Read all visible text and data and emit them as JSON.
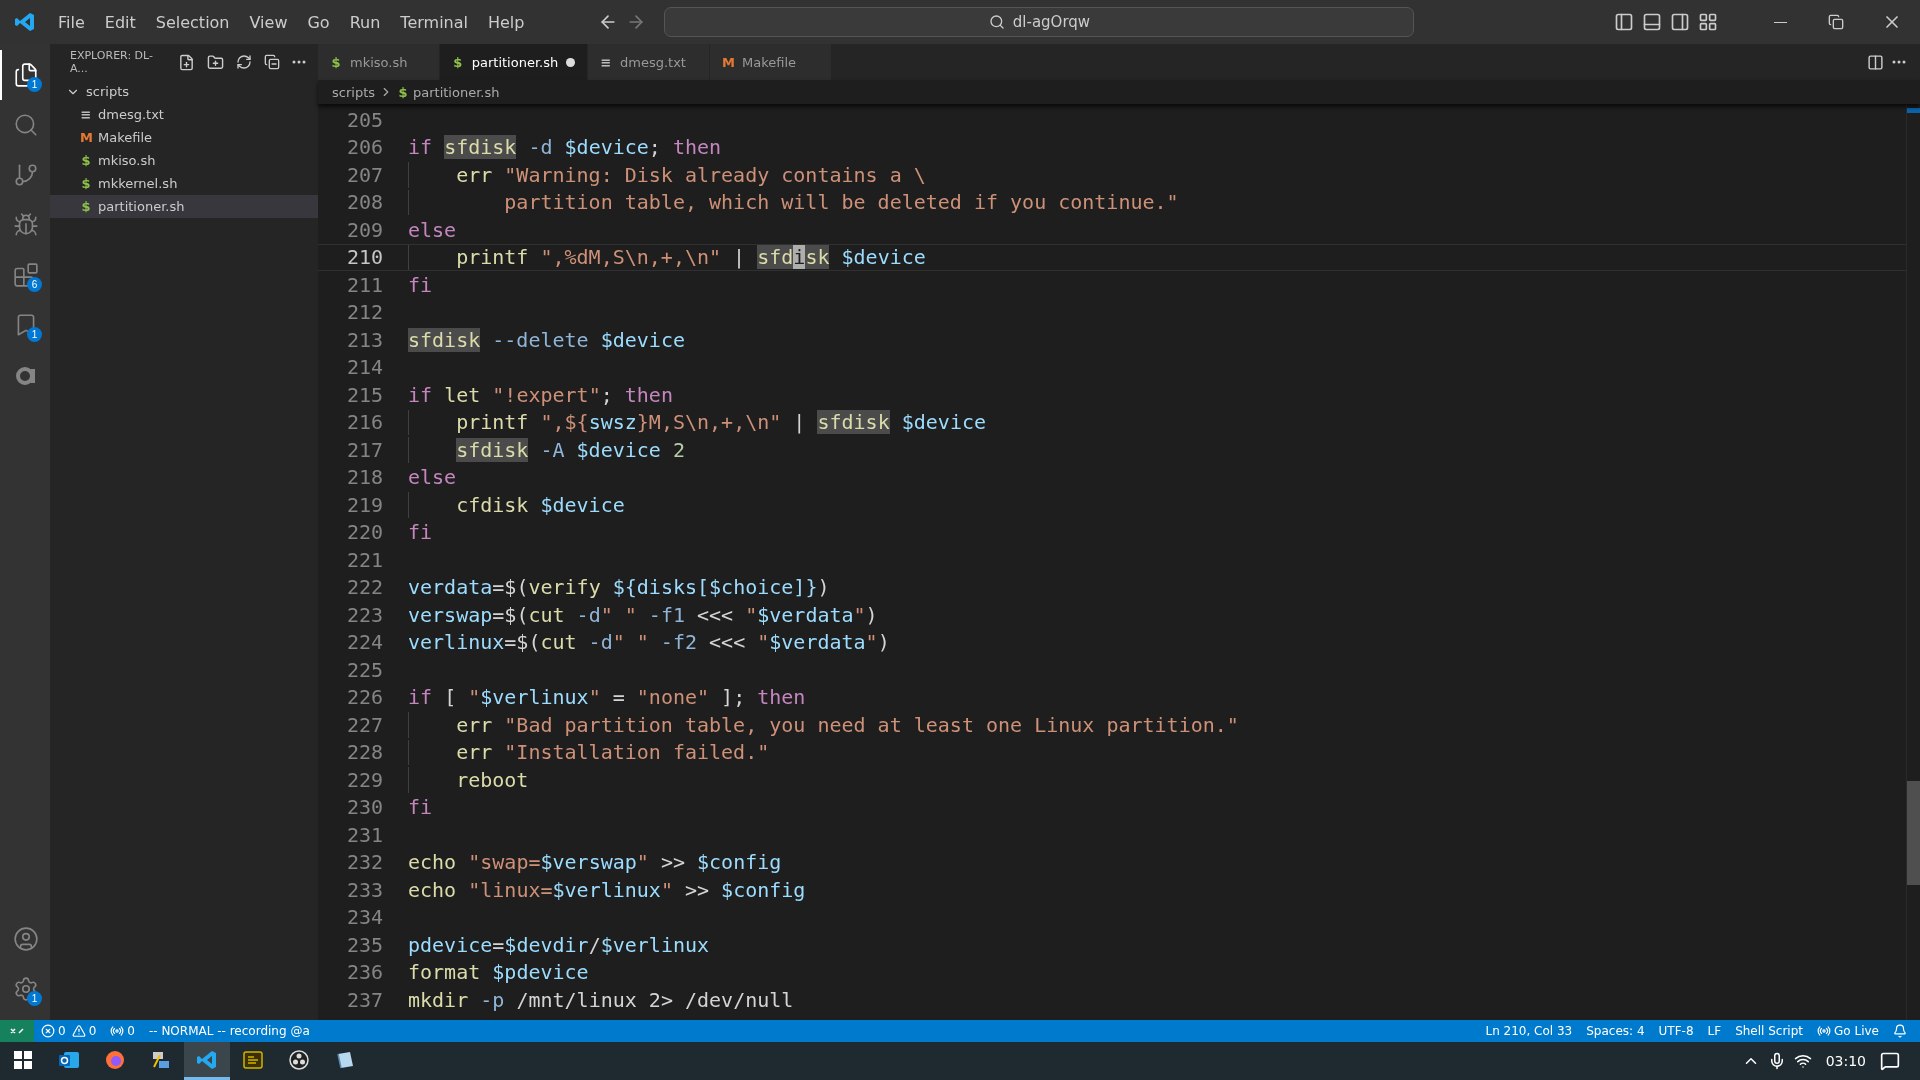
{
  "title_bar": {
    "menu": [
      "File",
      "Edit",
      "Selection",
      "View",
      "Go",
      "Run",
      "Terminal",
      "Help"
    ],
    "search": {
      "value": "dl-agOrqw"
    }
  },
  "activity_bar": {
    "items": [
      {
        "kind": "explorer",
        "selected": true,
        "badge": "1"
      },
      {
        "kind": "search",
        "selected": false
      },
      {
        "kind": "source-control",
        "selected": false
      },
      {
        "kind": "run",
        "selected": false
      },
      {
        "kind": "extensions",
        "selected": false,
        "badge": "6"
      },
      {
        "kind": "bookmark",
        "selected": false,
        "badge": "1"
      },
      {
        "kind": "ring",
        "selected": false
      }
    ],
    "bottom": [
      {
        "kind": "account"
      },
      {
        "kind": "settings",
        "badge": "1"
      }
    ]
  },
  "sidebar": {
    "title": "EXPLORER: DL-A...",
    "tree": [
      {
        "label": "scripts",
        "expanded": true,
        "selected": false,
        "children": [
          {
            "label": "dmesg.txt",
            "icon": "≡",
            "kind": "text",
            "selected": false
          },
          {
            "label": "Makefile",
            "icon": "M",
            "kind": "make",
            "selected": false
          },
          {
            "label": "mkiso.sh",
            "icon": "$",
            "kind": "shell",
            "selected": false
          },
          {
            "label": "mkkernel.sh",
            "icon": "$",
            "kind": "shell",
            "selected": false
          },
          {
            "label": "partitioner.sh",
            "icon": "$",
            "kind": "shell",
            "selected": true
          }
        ]
      }
    ]
  },
  "tabs": [
    {
      "label": "mkiso.sh",
      "icon": "$",
      "kind": "shell",
      "selected": false,
      "modified": false
    },
    {
      "label": "partitioner.sh",
      "icon": "$",
      "kind": "shell",
      "selected": true,
      "modified": true
    },
    {
      "label": "dmesg.txt",
      "icon": "≡",
      "kind": "text",
      "selected": false,
      "modified": false
    },
    {
      "label": "Makefile",
      "icon": "M",
      "kind": "make",
      "selected": false,
      "modified": false
    }
  ],
  "breadcrumbs": [
    {
      "label": "scripts"
    },
    {
      "label": "partitioner.sh",
      "icon": "$"
    }
  ],
  "editor": {
    "lines": [
      {
        "number": "205",
        "current": false
      },
      {
        "number": "206",
        "current": false,
        "indented": false,
        "tokens": [
          {
            "kind": "kw",
            "text": "if "
          },
          {
            "kind": "match",
            "text": "sfdisk"
          },
          {
            "kind": "flag",
            "text": " -d "
          },
          {
            "kind": "var",
            "text": "$device"
          },
          {
            "kind": "plain",
            "text": "; "
          },
          {
            "kind": "kw",
            "text": "then"
          }
        ]
      },
      {
        "number": "207",
        "current": false,
        "indented": true,
        "tokens": [
          {
            "kind": "fn",
            "text": "err "
          },
          {
            "kind": "str",
            "text": "\"Warning: Disk already contains a \\"
          }
        ]
      },
      {
        "number": "208",
        "current": false,
        "indented": true,
        "tokens": [
          {
            "kind": "str",
            "text": "    partition table, which will be deleted if you continue.\""
          }
        ]
      },
      {
        "number": "209",
        "current": false,
        "indented": false,
        "tokens": [
          {
            "kind": "kw",
            "text": "else"
          }
        ]
      },
      {
        "number": "210",
        "current": true,
        "indented": true,
        "tokens": [
          {
            "kind": "fn",
            "text": "printf "
          },
          {
            "kind": "str",
            "text": "\",%dM,S\\n,+,\\n\""
          },
          {
            "kind": "plain",
            "text": " | "
          },
          {
            "kind": "match",
            "text": "sfd"
          },
          {
            "kind": "cursor",
            "text": "i"
          },
          {
            "kind": "match",
            "text": "sk"
          },
          {
            "kind": "var",
            "text": " $device"
          }
        ]
      },
      {
        "number": "211",
        "current": false,
        "indented": false,
        "tokens": [
          {
            "kind": "kw",
            "text": "fi"
          }
        ]
      },
      {
        "number": "212",
        "current": false
      },
      {
        "number": "213",
        "current": false,
        "indented": false,
        "tokens": [
          {
            "kind": "match",
            "text": "sfdisk"
          },
          {
            "kind": "flag",
            "text": " --delete "
          },
          {
            "kind": "var",
            "text": "$device"
          }
        ]
      },
      {
        "number": "214",
        "current": false
      },
      {
        "number": "215",
        "current": false,
        "indented": false,
        "tokens": [
          {
            "kind": "kw",
            "text": "if "
          },
          {
            "kind": "fn",
            "text": "let "
          },
          {
            "kind": "str",
            "text": "\"!expert\""
          },
          {
            "kind": "plain",
            "text": "; "
          },
          {
            "kind": "kw",
            "text": "then"
          }
        ]
      },
      {
        "number": "216",
        "current": false,
        "indented": true,
        "tokens": [
          {
            "kind": "fn",
            "text": "printf "
          },
          {
            "kind": "str",
            "text": "\",${"
          },
          {
            "kind": "var",
            "text": "swsz"
          },
          {
            "kind": "str",
            "text": "}M,S\\n,+,\\n\""
          },
          {
            "kind": "plain",
            "text": " | "
          },
          {
            "kind": "match",
            "text": "sfdisk"
          },
          {
            "kind": "var",
            "text": " $device"
          }
        ]
      },
      {
        "number": "217",
        "current": false,
        "indented": true,
        "tokens": [
          {
            "kind": "match",
            "text": "sfdisk"
          },
          {
            "kind": "flag",
            "text": " -A "
          },
          {
            "kind": "var",
            "text": "$device"
          },
          {
            "kind": "num",
            "text": " 2"
          }
        ]
      },
      {
        "number": "218",
        "current": false,
        "indented": false,
        "tokens": [
          {
            "kind": "kw",
            "text": "else"
          }
        ]
      },
      {
        "number": "219",
        "current": false,
        "indented": true,
        "tokens": [
          {
            "kind": "fn",
            "text": "cfdisk "
          },
          {
            "kind": "var",
            "text": "$device"
          }
        ]
      },
      {
        "number": "220",
        "current": false,
        "indented": false,
        "tokens": [
          {
            "kind": "kw",
            "text": "fi"
          }
        ]
      },
      {
        "number": "221",
        "current": false
      },
      {
        "number": "222",
        "current": false,
        "indented": false,
        "tokens": [
          {
            "kind": "var",
            "text": "verdata"
          },
          {
            "kind": "plain",
            "text": "=$("
          },
          {
            "kind": "fn",
            "text": "verify "
          },
          {
            "kind": "var",
            "text": "${disks[$choice]}"
          },
          {
            "kind": "plain",
            "text": ")"
          }
        ]
      },
      {
        "number": "223",
        "current": false,
        "indented": false,
        "tokens": [
          {
            "kind": "var",
            "text": "verswap"
          },
          {
            "kind": "plain",
            "text": "=$("
          },
          {
            "kind": "fn",
            "text": "cut"
          },
          {
            "kind": "flag",
            "text": " -d"
          },
          {
            "kind": "str",
            "text": "\" \""
          },
          {
            "kind": "flag",
            "text": " -f1 "
          },
          {
            "kind": "plain",
            "text": "<<< "
          },
          {
            "kind": "str",
            "text": "\""
          },
          {
            "kind": "var",
            "text": "$verdata"
          },
          {
            "kind": "str",
            "text": "\""
          },
          {
            "kind": "plain",
            "text": ")"
          }
        ]
      },
      {
        "number": "224",
        "current": false,
        "indented": false,
        "tokens": [
          {
            "kind": "var",
            "text": "verlinux"
          },
          {
            "kind": "plain",
            "text": "=$("
          },
          {
            "kind": "fn",
            "text": "cut"
          },
          {
            "kind": "flag",
            "text": " -d"
          },
          {
            "kind": "str",
            "text": "\" \""
          },
          {
            "kind": "flag",
            "text": " -f2 "
          },
          {
            "kind": "plain",
            "text": "<<< "
          },
          {
            "kind": "str",
            "text": "\""
          },
          {
            "kind": "var",
            "text": "$verdata"
          },
          {
            "kind": "str",
            "text": "\""
          },
          {
            "kind": "plain",
            "text": ")"
          }
        ]
      },
      {
        "number": "225",
        "current": false
      },
      {
        "number": "226",
        "current": false,
        "indented": false,
        "tokens": [
          {
            "kind": "kw",
            "text": "if "
          },
          {
            "kind": "plain",
            "text": "[ "
          },
          {
            "kind": "str",
            "text": "\""
          },
          {
            "kind": "var",
            "text": "$verlinux"
          },
          {
            "kind": "str",
            "text": "\""
          },
          {
            "kind": "plain",
            "text": " = "
          },
          {
            "kind": "str",
            "text": "\"none\""
          },
          {
            "kind": "plain",
            "text": " ]; "
          },
          {
            "kind": "kw",
            "text": "then"
          }
        ]
      },
      {
        "number": "227",
        "current": false,
        "indented": true,
        "tokens": [
          {
            "kind": "fn",
            "text": "err "
          },
          {
            "kind": "str",
            "text": "\"Bad partition table, you need at least one Linux partition.\""
          }
        ]
      },
      {
        "number": "228",
        "current": false,
        "indented": true,
        "tokens": [
          {
            "kind": "fn",
            "text": "err "
          },
          {
            "kind": "str",
            "text": "\"Installation failed.\""
          }
        ]
      },
      {
        "number": "229",
        "current": false,
        "indented": true,
        "tokens": [
          {
            "kind": "fn",
            "text": "reboot"
          }
        ]
      },
      {
        "number": "230",
        "current": false,
        "indented": false,
        "tokens": [
          {
            "kind": "kw",
            "text": "fi"
          }
        ]
      },
      {
        "number": "231",
        "current": false
      },
      {
        "number": "232",
        "current": false,
        "indented": false,
        "tokens": [
          {
            "kind": "fn",
            "text": "echo "
          },
          {
            "kind": "str",
            "text": "\"swap="
          },
          {
            "kind": "var",
            "text": "$verswap"
          },
          {
            "kind": "str",
            "text": "\""
          },
          {
            "kind": "plain",
            "text": " >> "
          },
          {
            "kind": "var",
            "text": "$config"
          }
        ]
      },
      {
        "number": "233",
        "current": false,
        "indented": false,
        "tokens": [
          {
            "kind": "fn",
            "text": "echo "
          },
          {
            "kind": "str",
            "text": "\"linux="
          },
          {
            "kind": "var",
            "text": "$verlinux"
          },
          {
            "kind": "str",
            "text": "\""
          },
          {
            "kind": "plain",
            "text": " >> "
          },
          {
            "kind": "var",
            "text": "$config"
          }
        ]
      },
      {
        "number": "234",
        "current": false
      },
      {
        "number": "235",
        "current": false,
        "indented": false,
        "tokens": [
          {
            "kind": "var",
            "text": "pdevice"
          },
          {
            "kind": "plain",
            "text": "="
          },
          {
            "kind": "var",
            "text": "$devdir"
          },
          {
            "kind": "plain",
            "text": "/"
          },
          {
            "kind": "var",
            "text": "$verlinux"
          }
        ]
      },
      {
        "number": "236",
        "current": false,
        "indented": false,
        "tokens": [
          {
            "kind": "fn",
            "text": "format "
          },
          {
            "kind": "var",
            "text": "$pdevice"
          }
        ]
      },
      {
        "number": "237",
        "current": false,
        "indented": false,
        "tokens": [
          {
            "kind": "fn",
            "text": "mkdir"
          },
          {
            "kind": "flag",
            "text": " -p "
          },
          {
            "kind": "plain",
            "text": "/mnt/linux 2> /dev/null"
          }
        ]
      }
    ]
  },
  "status_bar": {
    "errors": "0",
    "warnings": "0",
    "ports": "0",
    "mode": "-- NORMAL -- recording @a",
    "position": "Ln 210, Col 33",
    "indent": "Spaces: 4",
    "encoding": "UTF-8",
    "eol": "LF",
    "language": "Shell Script",
    "live": "Go Live"
  },
  "taskbar": {
    "apps": [
      {
        "kind": "mail",
        "selected": false
      },
      {
        "kind": "browser",
        "selected": false
      },
      {
        "kind": "network",
        "selected": false
      },
      {
        "kind": "editor",
        "selected": true
      },
      {
        "kind": "transfer",
        "selected": false
      },
      {
        "kind": "recorder",
        "selected": false
      },
      {
        "kind": "notes",
        "selected": false
      }
    ],
    "clock": "03:10"
  }
}
